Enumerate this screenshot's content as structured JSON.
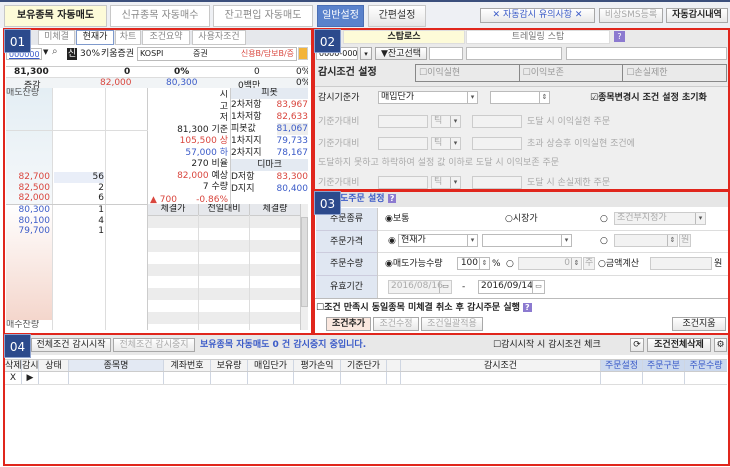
{
  "top_tabs": [
    {
      "label": "보유종목 자동매도",
      "active": true
    },
    {
      "label": "신규종목 자동매수"
    },
    {
      "label": "잔고편입 자동매도"
    },
    {
      "label": "일반설정"
    },
    {
      "label": "간편설정"
    }
  ],
  "top_buttons": {
    "notice": "✕ 자동감시 유의사항 ✕",
    "sms": "비상SMS등록",
    "history": "자동감시내역"
  },
  "section_labels": [
    "01",
    "02",
    "03",
    "04"
  ],
  "panel01": {
    "subtabs": [
      "미체결",
      "현재가",
      "차트",
      "조건요약",
      "사용자조건"
    ],
    "code": "000000",
    "badge_credit": "신",
    "margin": "30%",
    "stock_name": "키움증권",
    "market": "KOSPI",
    "sector": "증권",
    "credit_info": "신용B/담보B/증",
    "summary_row1": [
      "81,300",
      "0",
      "0%",
      "0",
      "0%"
    ],
    "summary_row2": {
      "label": "증감",
      "high": "82,000",
      "low": "80,300",
      "amount": "0백만",
      "pct": "0%"
    },
    "sell_remain": "매도잔량",
    "buy_remain": "매수잔량",
    "asks": [
      {
        "price": "82,700",
        "qty": "56"
      },
      {
        "price": "82,500",
        "qty": "2"
      },
      {
        "price": "82,000",
        "qty": "6"
      }
    ],
    "bids": [
      {
        "price": "80,300",
        "qty": "1"
      },
      {
        "price": "80,100",
        "qty": "4"
      },
      {
        "price": "79,700",
        "qty": "1"
      }
    ],
    "info": [
      {
        "v": "",
        "k": "시"
      },
      {
        "v": "",
        "k": "고"
      },
      {
        "v": "",
        "k": "저"
      },
      {
        "v": "81,300",
        "k": "기준"
      },
      {
        "v": "105,500",
        "k": "상"
      },
      {
        "v": "57,000",
        "k": "하"
      },
      {
        "v": "270",
        "k": "비율"
      },
      {
        "v": "82,000",
        "k": "예상"
      },
      {
        "v": "7",
        "k": "수량"
      }
    ],
    "change": {
      "arrow": "▲",
      "value": "700",
      "pct": "-0.86%"
    },
    "pivot": {
      "title": "피봇",
      "rows": [
        {
          "k": "2차저항",
          "v": "83,967"
        },
        {
          "k": "1차저항",
          "v": "82,633"
        },
        {
          "k": "피봇값",
          "v": "81,067"
        },
        {
          "k": "1차지지",
          "v": "79,733"
        },
        {
          "k": "2차지지",
          "v": "78,167"
        }
      ]
    },
    "demark": {
      "title": "디마크",
      "rows": [
        {
          "k": "D저항",
          "v": "83,300"
        },
        {
          "k": "D지지",
          "v": "80,400"
        }
      ]
    },
    "trade_headers": [
      "체결가",
      "전일대비",
      "체결량"
    ]
  },
  "panel02": {
    "tabs": [
      "스탑로스",
      "트레일링 스탑"
    ],
    "help": "?",
    "account": "0000-0000",
    "balance_select": "▼잔고선택",
    "cond_title": "감시조건 설정",
    "cond_checks": [
      "이익실현",
      "이익보존",
      "손실제한"
    ],
    "base_label": "감시기준가",
    "base_value": "매입단가",
    "reset_check": "종목변경시 조건 설정 초기화",
    "ref_label": "기준가대비",
    "tick": "틱",
    "line1": "도달 시  이익실현  주문",
    "line2": "초과 상승후 이익실현 조건에",
    "line3": "도달하지 못하고 하락하여 설정 값 이하로 도달 시  이익보존 주문",
    "line4": "도달 시 손실제한 주문"
  },
  "panel03": {
    "title": "도주문 설정",
    "help": "?",
    "rows": {
      "type": "주문종류",
      "price": "주문가격",
      "qty": "주문수량",
      "period": "유효기간"
    },
    "type_opts": [
      "보통",
      "시장가"
    ],
    "cond_price": "조건부지정가",
    "price_sel": "현재가",
    "won": "원",
    "qty_opt": "매도가능수량",
    "qty_val": "100",
    "pct": "%",
    "share_val": "0",
    "share_unit": "주",
    "amount_opt": "금액계산",
    "date_from": "2016/08/16",
    "date_sep": "-",
    "date_to": "2016/09/14",
    "cancel_check": "조건 만족시 동일종목 미체결 취소 후 감시주문 실행",
    "buttons": {
      "add": "조건추가",
      "edit": "조건수정",
      "apply_all": "조건일괄적용",
      "clear": "조건지움"
    }
  },
  "panel04": {
    "start": "전체조건 감시시작",
    "stop": "전체조건 감시중지",
    "message": "보유종목 자동매도 0 건 감시중지 중입니다.",
    "check": "감시시작 시 감시조건 체크",
    "delete_all": "조건전체삭제",
    "headers": [
      "삭제",
      "감시",
      "상태",
      "종목명",
      "계좌번호",
      "보유량",
      "매입단가",
      "평가손익",
      "기준단가",
      "",
      "감시조건",
      "주문설정",
      "주문구분",
      "주문수량"
    ],
    "row": {
      "delete": "X",
      "watch": "▶"
    }
  }
}
